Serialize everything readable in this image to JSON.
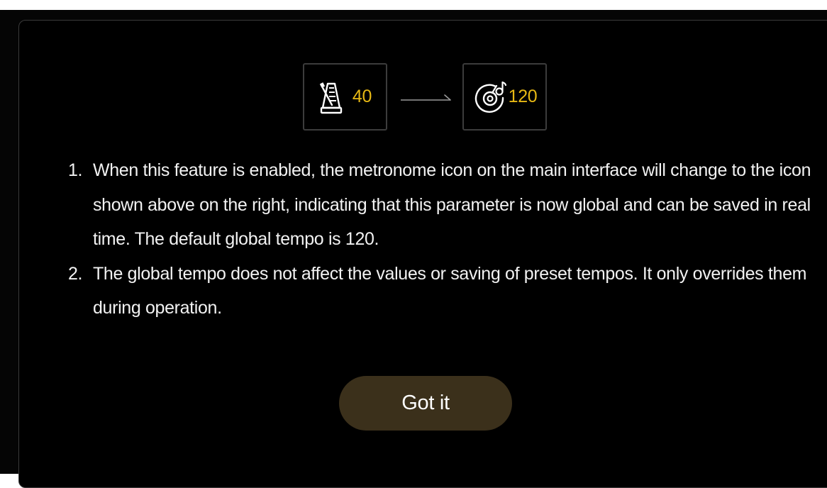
{
  "colors": {
    "accent_yellow": "#e7b814",
    "button_bg": "#3b301b",
    "text": "#f2f2f2",
    "box_border": "#3c3c3c",
    "dialog_bg": "#000000"
  },
  "tempo_demo": {
    "before_icon": "metronome-icon",
    "before_value": "40",
    "arrow_icon": "arrow-right-icon",
    "after_icon": "global-tempo-icon",
    "after_value": "120"
  },
  "notes": [
    {
      "number": "1.",
      "text": "When this feature is enabled, the metronome icon on the main interface will change to the icon shown above on the right, indicating that this parameter is now global and can be saved in real time. The default global tempo is 120."
    },
    {
      "number": "2.",
      "text": "The global tempo does not affect the values or saving of preset tempos. It only overrides them during operation."
    }
  ],
  "confirm_button": {
    "label": "Got it"
  }
}
